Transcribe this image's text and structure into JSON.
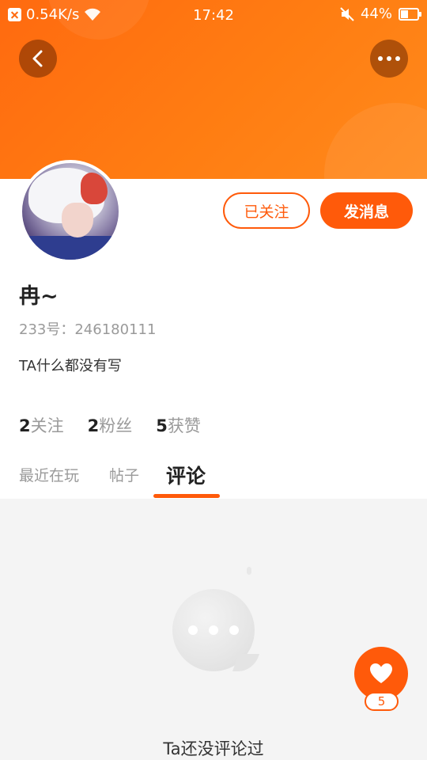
{
  "status_bar": {
    "speed": "0.54K/s",
    "time": "17:42",
    "battery": "44%",
    "battery_level": 0.44
  },
  "header": {
    "back_icon": "chevron-left-icon",
    "more_icon": "more-horizontal-icon"
  },
  "profile": {
    "name": "冉~",
    "uid": "233号：246180111",
    "bio": "TA什么都没有写",
    "follow_label": "已关注",
    "message_label": "发消息"
  },
  "stats": [
    {
      "num": "2",
      "label": "关注"
    },
    {
      "num": "2",
      "label": "粉丝"
    },
    {
      "num": "5",
      "label": "获赞"
    }
  ],
  "tabs": [
    {
      "label": "最近在玩"
    },
    {
      "label": "帖子"
    },
    {
      "label": "评论",
      "active": true
    }
  ],
  "empty_state": {
    "icon": "chat-bubble-icon",
    "text": "Ta还没评论过"
  },
  "like_fab": {
    "icon": "heart-icon",
    "count": "5"
  },
  "colors": {
    "accent": "#ff5a0a",
    "header_gradient_start": "#ff6a10",
    "header_gradient_end": "#ff8a1c"
  }
}
